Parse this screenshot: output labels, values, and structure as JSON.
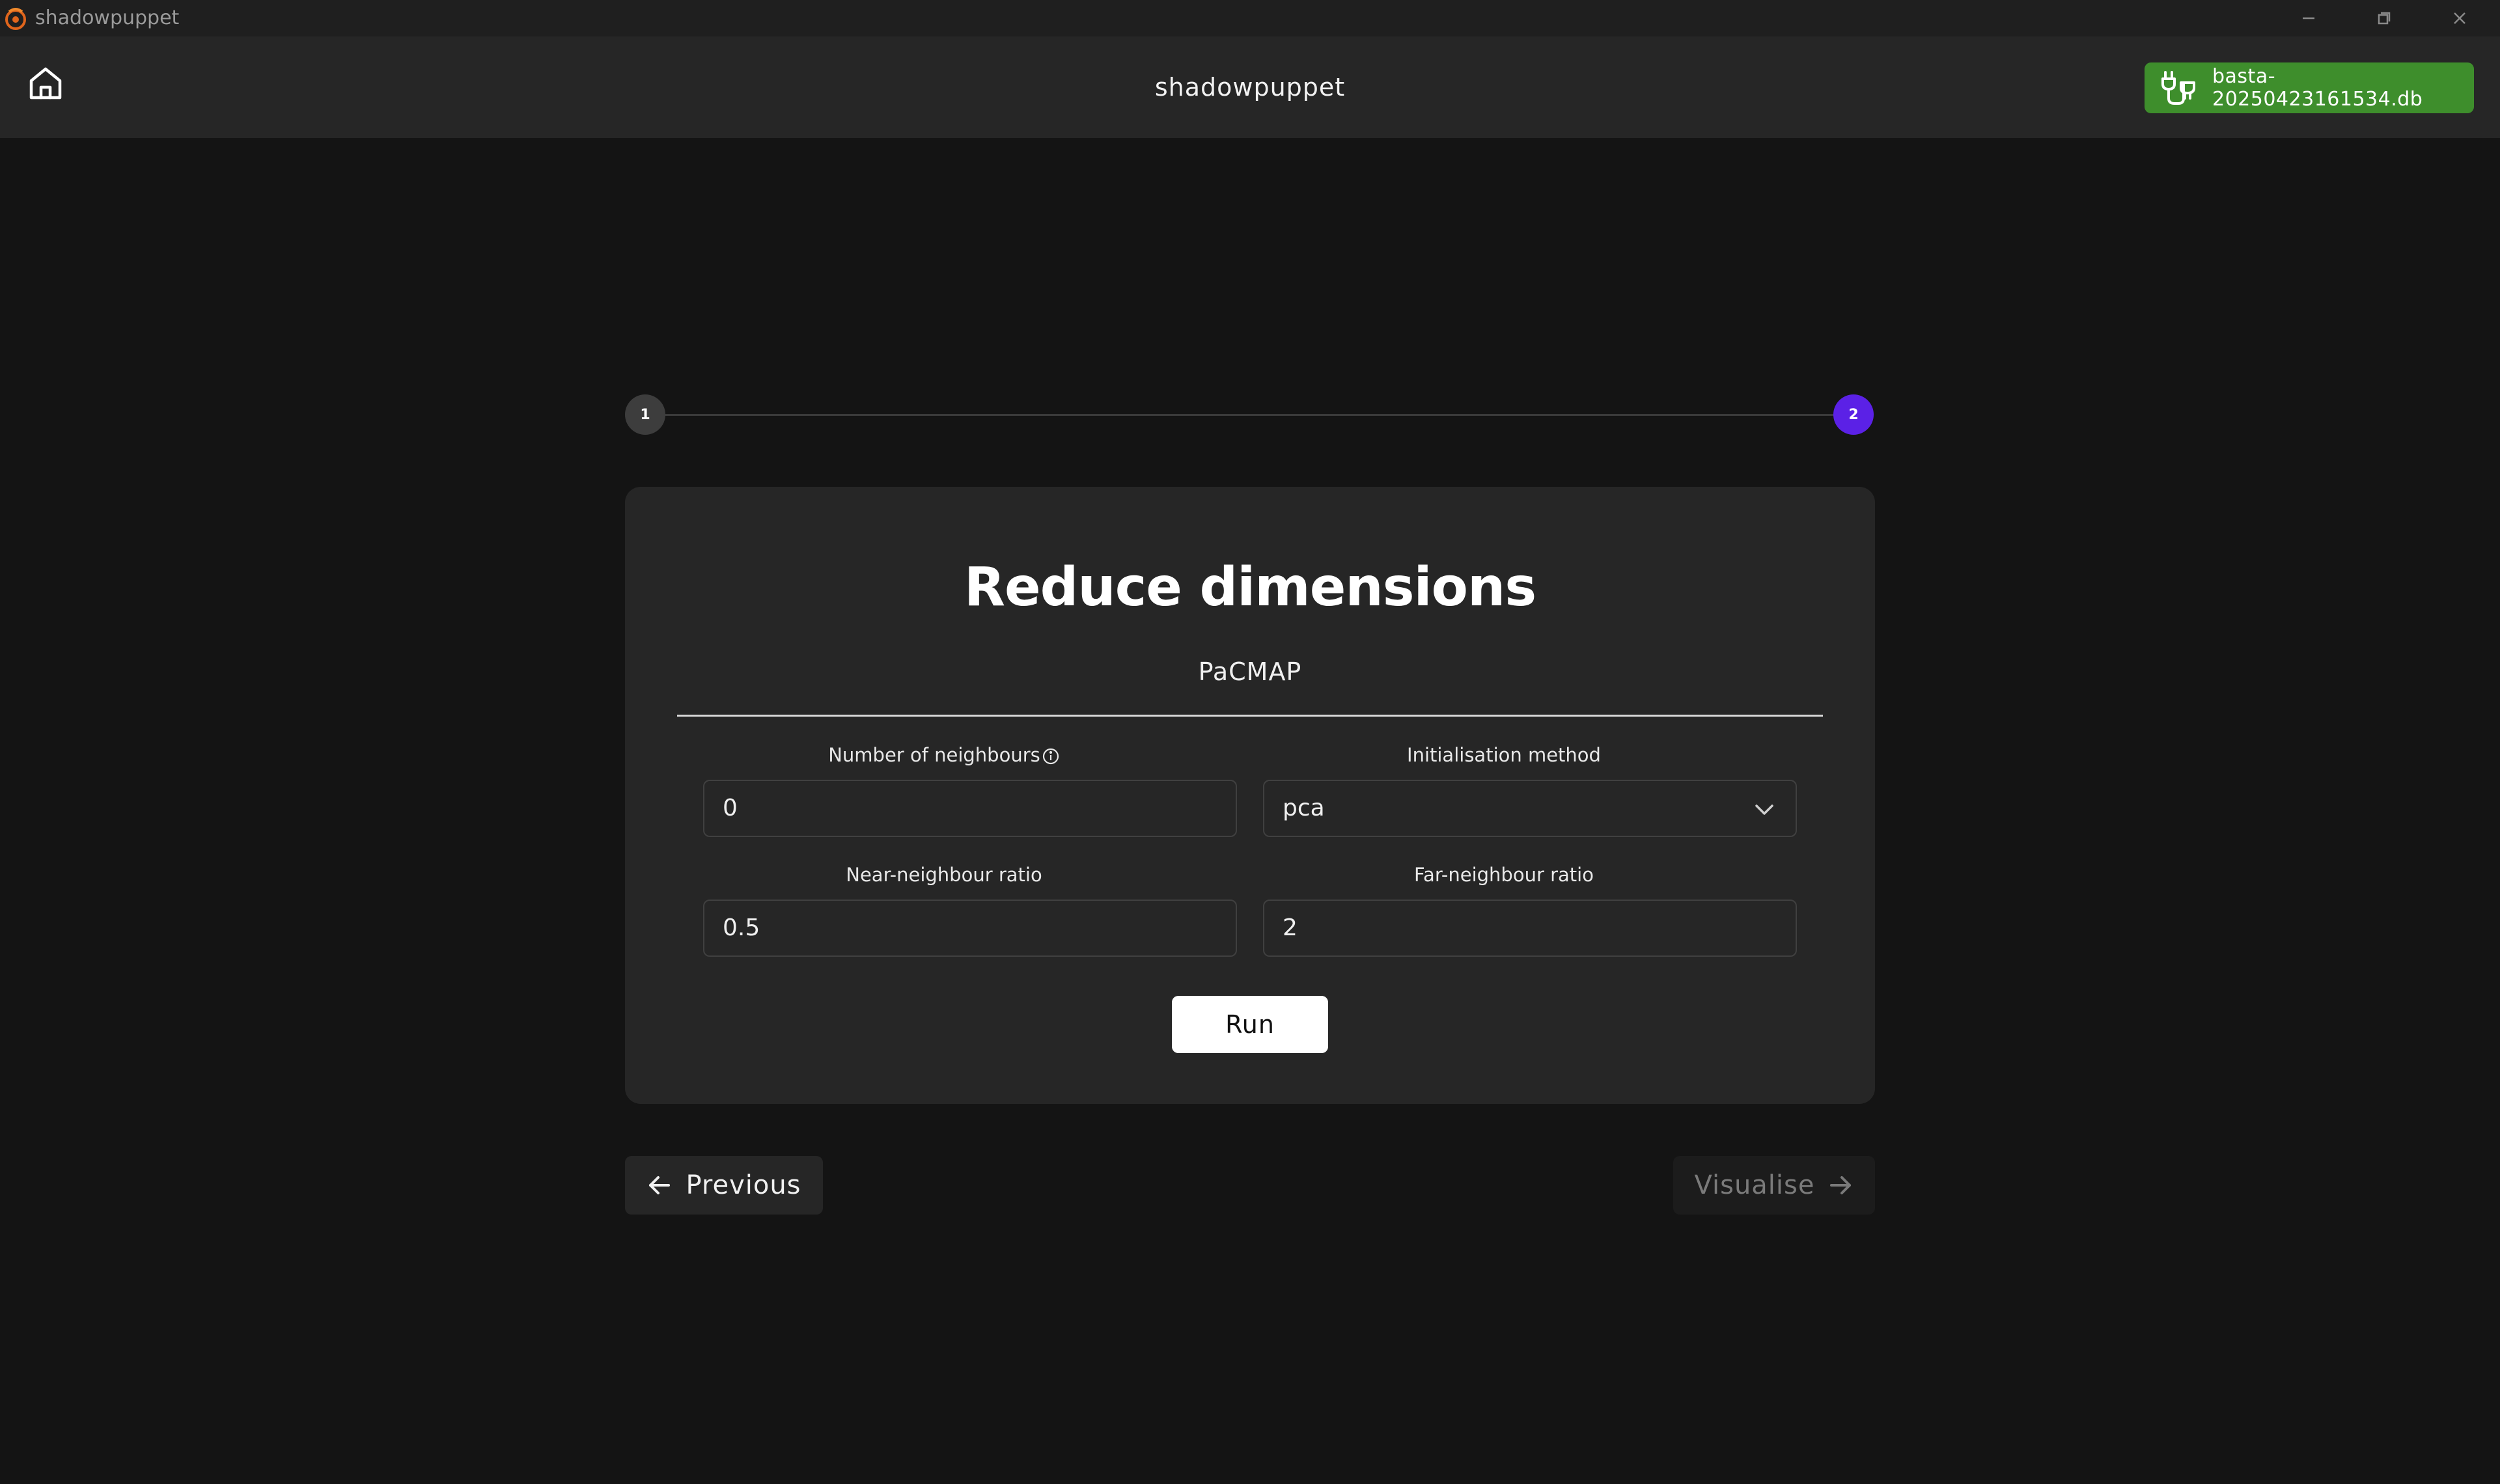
{
  "window": {
    "app_name": "shadowpuppet",
    "controls": [
      "minimize-icon",
      "restore-icon",
      "close-icon"
    ]
  },
  "header": {
    "home_icon": "home-icon",
    "title": "shadowpuppet",
    "database": {
      "icon": "plug-icon",
      "label": "basta-20250423161534.db",
      "color": "#3e8e2c"
    }
  },
  "stepper": {
    "steps": [
      {
        "label": "1",
        "state": "inactive",
        "color": "#3d3d3d"
      },
      {
        "label": "2",
        "state": "active",
        "color": "#5b21e6"
      }
    ]
  },
  "card": {
    "title": "Reduce dimensions",
    "tab": "PaCMAP",
    "fields": {
      "neighbours": {
        "label": "Number of neighbours",
        "value": "0",
        "info_icon": "info-icon"
      },
      "init_method": {
        "label": "Initialisation method",
        "value": "pca",
        "icon": "chevron-down-icon"
      },
      "near_ratio": {
        "label": "Near-neighbour ratio",
        "value": "0.5"
      },
      "far_ratio": {
        "label": "Far-neighbour ratio",
        "value": "2"
      }
    },
    "run_label": "Run"
  },
  "nav": {
    "previous_label": "Previous",
    "next_label": "Visualise",
    "next_enabled": false
  }
}
